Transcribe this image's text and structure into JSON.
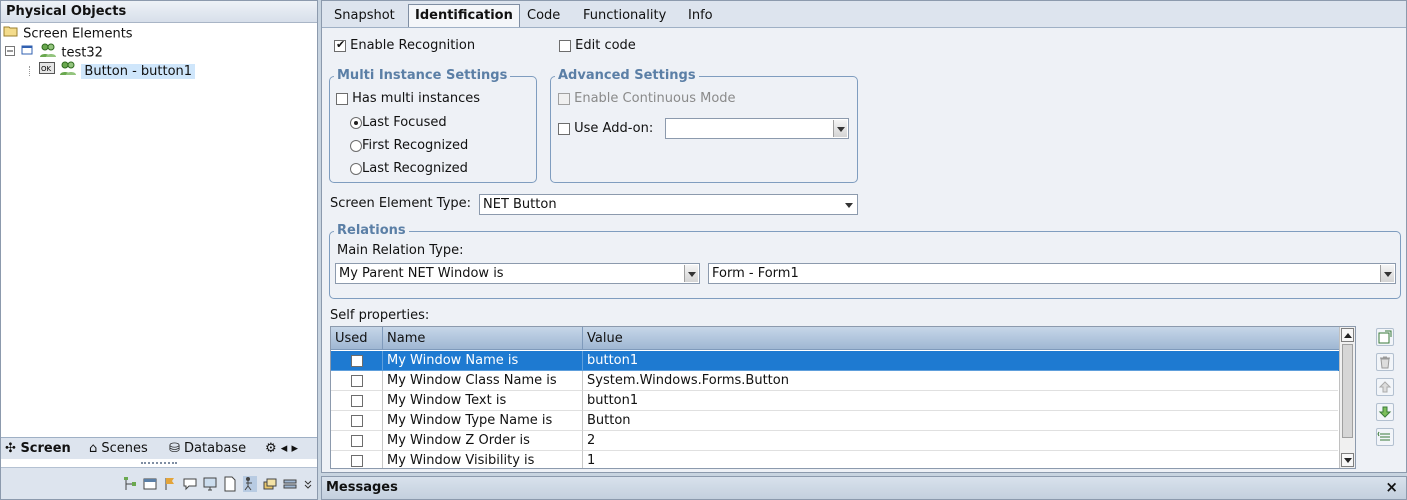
{
  "left_panel": {
    "title": "Physical Objects",
    "tree": {
      "root": "Screen Elements",
      "node": "test32",
      "leaf": "Button - button1"
    },
    "tabs": [
      "Screen",
      "Scenes",
      "Database"
    ]
  },
  "tabs": [
    "Snapshot",
    "Identification",
    "Code",
    "Functionality",
    "Info"
  ],
  "active_tab": "Identification",
  "enable_recognition": {
    "label": "Enable Recognition",
    "checked": true
  },
  "edit_code": {
    "label": "Edit code",
    "checked": false
  },
  "multi_instance": {
    "title": "Multi Instance Settings",
    "has_multi": {
      "label": "Has multi instances",
      "checked": false
    },
    "options": [
      "Last Focused",
      "First Recognized",
      "Last Recognized"
    ],
    "selected": "Last Focused"
  },
  "advanced": {
    "title": "Advanced Settings",
    "continuous": {
      "label": "Enable Continuous Mode",
      "checked": false,
      "disabled": true
    },
    "addon": {
      "label": "Use Add-on:",
      "checked": false,
      "value": ""
    }
  },
  "screen_element_type": {
    "label": "Screen Element Type:",
    "value": "NET Button"
  },
  "relations": {
    "title": "Relations",
    "main_label": "Main Relation Type:",
    "relation": "My Parent NET Window is",
    "target": "Form - Form1"
  },
  "self_properties": {
    "label": "Self properties:",
    "columns": [
      "Used",
      "Name",
      "Value"
    ],
    "rows": [
      {
        "used": true,
        "name": "My Window Name is",
        "value": "button1"
      },
      {
        "used": false,
        "name": "My Window Class Name is",
        "value": "System.Windows.Forms.Button"
      },
      {
        "used": false,
        "name": "My Window Text is",
        "value": "button1"
      },
      {
        "used": false,
        "name": "My Window Type Name is",
        "value": "Button"
      },
      {
        "used": false,
        "name": "My Window Z Order is",
        "value": "2"
      },
      {
        "used": false,
        "name": "My Window Visibility is",
        "value": "1"
      }
    ]
  },
  "messages": {
    "title": "Messages",
    "close": "×"
  }
}
